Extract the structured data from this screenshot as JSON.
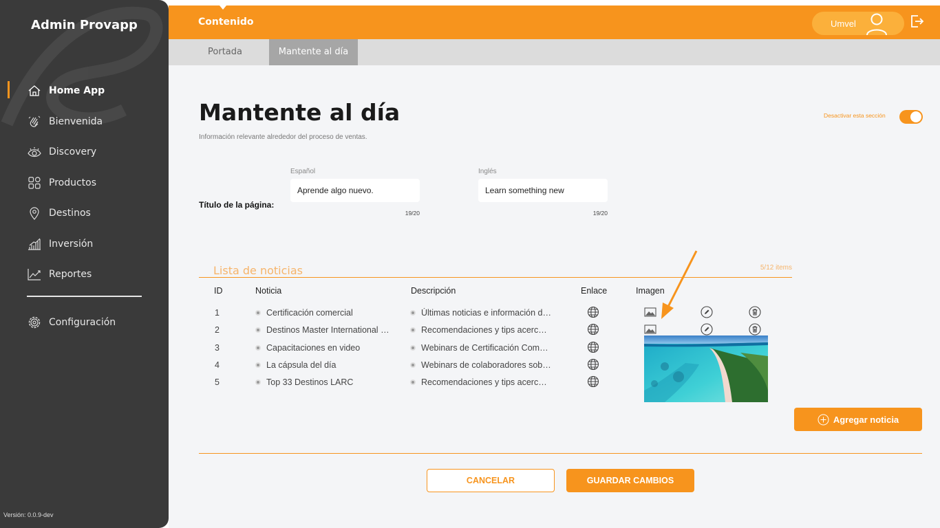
{
  "app": {
    "brand": "Admin Provapp",
    "version": "Versión: 0.0.9-dev"
  },
  "sidebar": {
    "items": [
      {
        "label": "Home App",
        "icon": "home-icon",
        "active": true
      },
      {
        "label": "Bienvenida",
        "icon": "wave-hand-icon"
      },
      {
        "label": "Discovery",
        "icon": "eye-icon"
      },
      {
        "label": "Productos",
        "icon": "grid-icon"
      },
      {
        "label": "Destinos",
        "icon": "location-pin-icon"
      },
      {
        "label": "Inversión",
        "icon": "bar-chart-icon"
      },
      {
        "label": "Reportes",
        "icon": "line-chart-icon"
      }
    ],
    "config": {
      "label": "Configuración",
      "icon": "gear-icon"
    }
  },
  "header": {
    "title": "Contenido",
    "user": "Umvel"
  },
  "tabs": [
    {
      "label": "Portada"
    },
    {
      "label": "Mantente al día",
      "active": true
    }
  ],
  "page": {
    "title": "Mantente al día",
    "subtitle": "Información relevante alrededor del proceso de ventas.",
    "toggle_label": "Desactivar esta sección",
    "toggle_on": true
  },
  "title_field": {
    "label": "Título de la página:",
    "es": {
      "label": "Español",
      "value": "Aprende algo nuevo.",
      "counter": "19/20"
    },
    "en": {
      "label": "Inglés",
      "value": "Learn something new",
      "counter": "19/20"
    }
  },
  "news": {
    "title": "Lista de noticias",
    "count": "5/12 items",
    "headers": {
      "id": "ID",
      "noticia": "Noticia",
      "descripcion": "Descripción",
      "enlace": "Enlace",
      "imagen": "Imagen"
    },
    "rows": [
      {
        "id": "1",
        "noticia": "Certificación comercial",
        "descripcion": "Últimas noticias e información de certificación"
      },
      {
        "id": "2",
        "noticia": "Destinos Master International Certification",
        "descripcion": "Recomendaciones y tips acerca de destinos"
      },
      {
        "id": "3",
        "noticia": "Capacitaciones en video",
        "descripcion": "Webinars de Certificación Comercial"
      },
      {
        "id": "4",
        "noticia": "La cápsula del día",
        "descripcion": "Webinars de colaboradores sobre destinos"
      },
      {
        "id": "5",
        "noticia": "Top 33 Destinos LARC",
        "descripcion": "Recomendaciones y tips acerca de destinos"
      }
    ],
    "add_label": "Agregar noticia"
  },
  "actions": {
    "cancel": "CANCELAR",
    "save": "GUARDAR CAMBIOS"
  },
  "colors": {
    "accent": "#f7941d",
    "sidebar": "#3a3a3a"
  }
}
